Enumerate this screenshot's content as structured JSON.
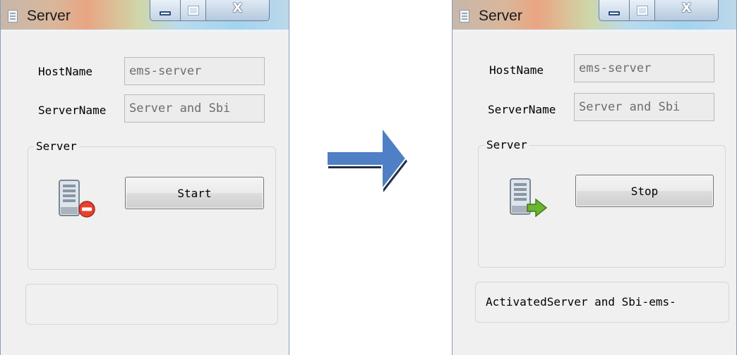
{
  "windows": [
    {
      "title": "Server",
      "hostname_label": "HostName",
      "hostname_value": "ems-server",
      "servername_label": "ServerName",
      "servername_value": "Server and Sbi",
      "group_title": "Server",
      "button_label": "Start",
      "server_icon": "server-stopped-icon",
      "status_text": ""
    },
    {
      "title": "Server",
      "hostname_label": "HostName",
      "hostname_value": "ems-server",
      "servername_label": "ServerName",
      "servername_value": "Server and Sbi",
      "group_title": "Server",
      "button_label": "Stop",
      "server_icon": "server-running-icon",
      "status_text": "ActivatedServer and Sbi-ems-"
    }
  ],
  "transition_icon": "right-arrow-icon",
  "colors": {
    "arrow_fill": "#4f7fc4",
    "stopped_badge": "#e8412e",
    "running_badge": "#6cb431"
  }
}
